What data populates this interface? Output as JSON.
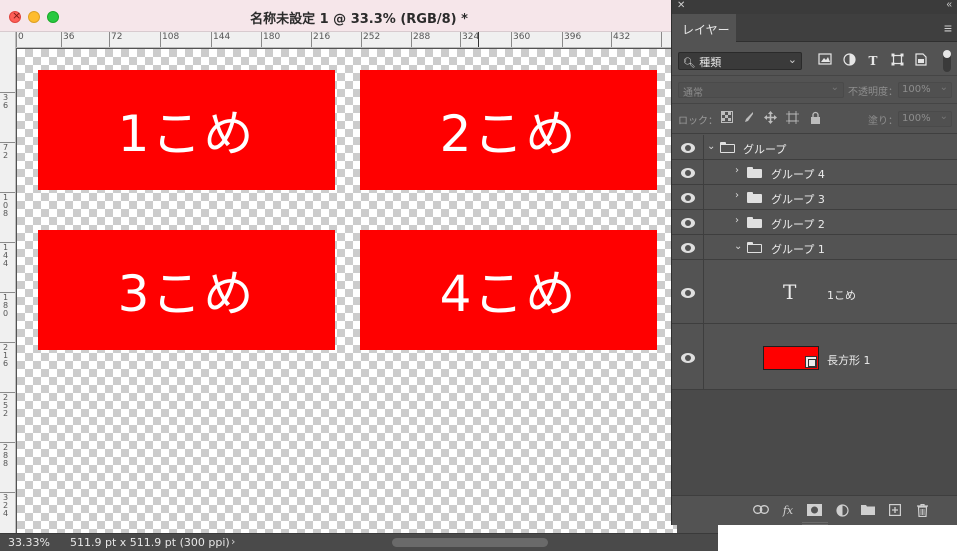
{
  "document": {
    "title": "名称未設定 1 @ 33.3% (RGB/8) *",
    "ruler_top_labels": [
      "0",
      "36",
      "72",
      "108",
      "144",
      "180",
      "216",
      "252",
      "288",
      "324",
      "360",
      "396",
      "432"
    ],
    "ruler_left_labels": [
      "36",
      "72",
      "108",
      "144",
      "180",
      "216",
      "252",
      "288",
      "324"
    ],
    "rectangles": [
      {
        "text": "1こめ",
        "color": "#ff0000"
      },
      {
        "text": "2こめ",
        "color": "#ff0000"
      },
      {
        "text": "3こめ",
        "color": "#ff0000"
      },
      {
        "text": "4こめ",
        "color": "#ff0000"
      }
    ],
    "status": {
      "zoom": "33.33%",
      "doc_info": "511.9 pt x 511.9 pt (300 ppi)"
    }
  },
  "panel": {
    "tab": "レイヤー",
    "filter_kind": "種類",
    "blend_mode": "通常",
    "opacity_label": "不透明度：",
    "opacity_value": "100%",
    "lock_label": "ロック：",
    "fill_label": "塗り：",
    "fill_value": "100%",
    "layers": [
      {
        "name": "グループ",
        "type": "group",
        "expanded": true,
        "depth": 0
      },
      {
        "name": "グループ 4",
        "type": "group",
        "expanded": false,
        "depth": 1
      },
      {
        "name": "グループ 3",
        "type": "group",
        "expanded": false,
        "depth": 1
      },
      {
        "name": "グループ 2",
        "type": "group",
        "expanded": false,
        "depth": 1
      },
      {
        "name": "グループ 1",
        "type": "group",
        "expanded": true,
        "depth": 1
      },
      {
        "name": "1こめ",
        "type": "text",
        "depth": 2
      },
      {
        "name": "長方形 1",
        "type": "shape",
        "depth": 2,
        "thumb_color": "#ff0000"
      }
    ],
    "bottom_icons": [
      "link-icon",
      "fx-icon",
      "mask-icon",
      "adjustment-icon",
      "new-group-icon",
      "new-layer-icon",
      "trash-icon"
    ],
    "fx_label": "fx"
  },
  "colors": {
    "accent_red": "#ff0000",
    "panel_bg": "#535353",
    "titlebar_bg": "#f6e6ea"
  }
}
